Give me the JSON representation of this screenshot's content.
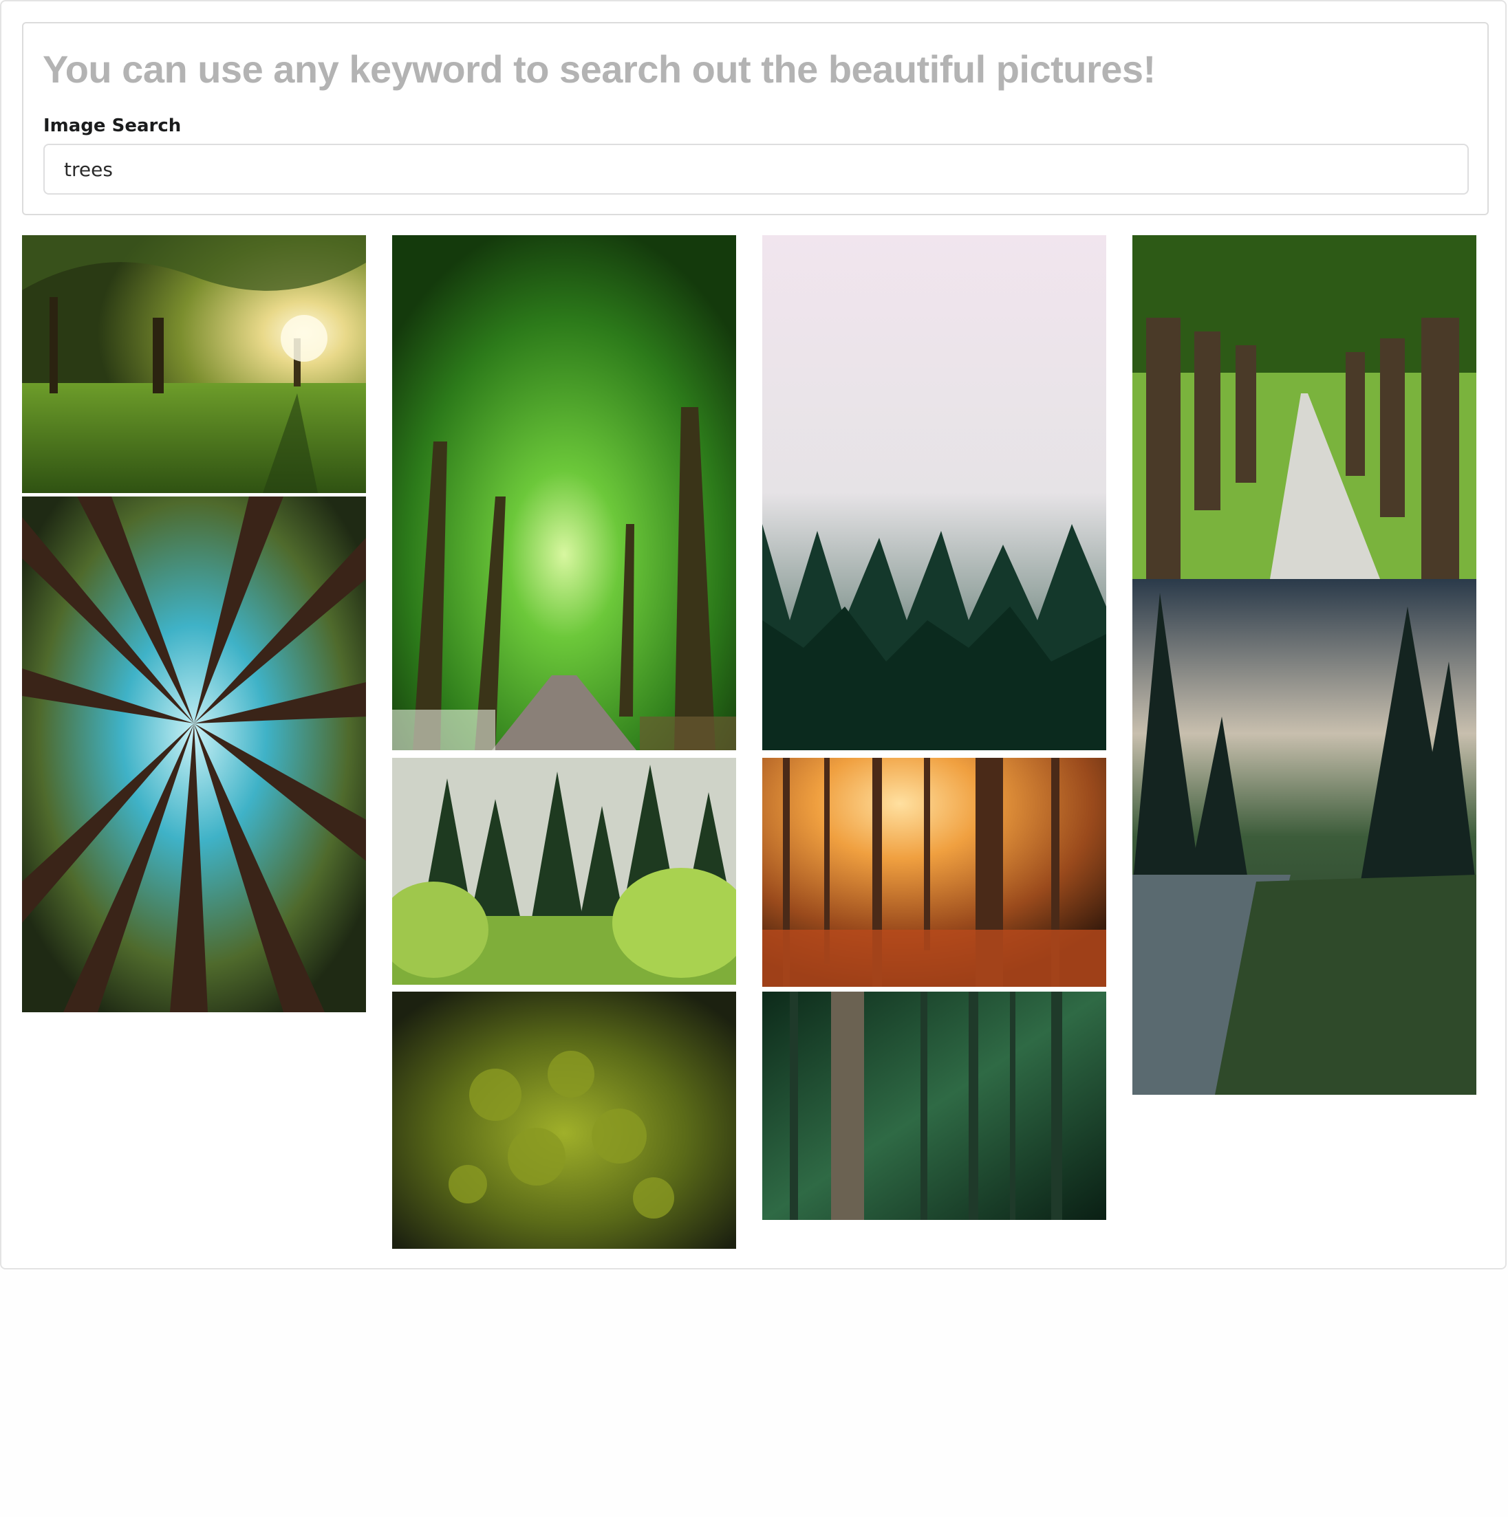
{
  "page": {
    "headline": "You can use any keyword to search out the beautiful pictures!"
  },
  "search": {
    "label": "Image Search",
    "value": "trees"
  },
  "results": {
    "images": [
      {
        "subject": "sunlit park trees",
        "colors": [
          "#2f4a1c",
          "#f4e7a0",
          "#6f9a2a"
        ]
      },
      {
        "subject": "redwood canopy from below",
        "colors": [
          "#3a2418",
          "#3fb2c7",
          "#58702e"
        ]
      },
      {
        "subject": "green tree tunnel with road",
        "colors": [
          "#1d4d12",
          "#6cc83a",
          "#8a8078"
        ]
      },
      {
        "subject": "pine forest meadow",
        "colors": [
          "#1e3a20",
          "#9fc74c",
          "#cfd3c8"
        ]
      },
      {
        "subject": "aerial conifer treetops",
        "colors": [
          "#1f2410",
          "#8a9a22",
          "#4a5515"
        ]
      },
      {
        "subject": "misty pine forest",
        "colors": [
          "#f0e6ee",
          "#0f2e23",
          "#b8c0be"
        ]
      },
      {
        "subject": "autumn forest sunrise",
        "colors": [
          "#5a2a12",
          "#f0a040",
          "#b94a1c"
        ]
      },
      {
        "subject": "dark green forest trunks",
        "colors": [
          "#0d2a1a",
          "#3f7a52",
          "#6b6252"
        ]
      },
      {
        "subject": "tree-lined path",
        "colors": [
          "#2d5a16",
          "#7ab33d",
          "#d8d8d2"
        ]
      },
      {
        "subject": "river valley with firs",
        "colors": [
          "#1b2a2e",
          "#c8bfae",
          "#3c5c3a"
        ]
      }
    ]
  }
}
